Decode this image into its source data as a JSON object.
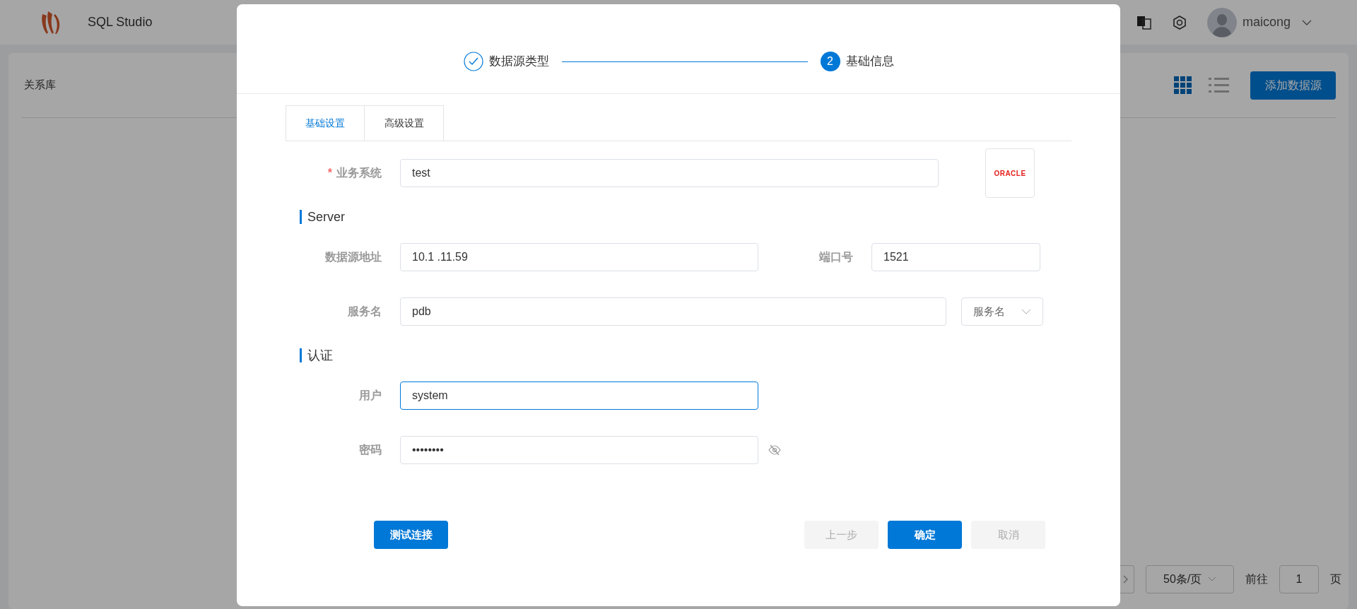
{
  "app": {
    "title": "SQL Studio",
    "user": "maicong"
  },
  "page": {
    "title": "关系库",
    "add_button": "添加数据源",
    "views": [
      {
        "kind": "grid",
        "selected": true
      },
      {
        "kind": "list",
        "selected": false
      }
    ]
  },
  "pagination": {
    "page_size": "50条/页",
    "goto_label": "前往",
    "page": "1",
    "page_unit": "页"
  },
  "dialog": {
    "steps": [
      {
        "label": "数据源类型",
        "done": true
      },
      {
        "label": "基础信息",
        "number": "2",
        "done": false
      }
    ],
    "tabs": [
      {
        "label": "基础设置",
        "selected": true
      },
      {
        "label": "高级设置",
        "selected": false
      }
    ],
    "logo": "ORACLE",
    "required_mark": "*",
    "rows": [
      {
        "kind": "fields",
        "fields": [
          {
            "label": "业务系统",
            "required": true,
            "value": "test",
            "focused": false
          }
        ]
      },
      {
        "kind": "heading",
        "label": "Server"
      },
      {
        "kind": "fields",
        "fields": [
          {
            "label": "数据源地址",
            "required": false,
            "value": "10.1 .11.59",
            "focused": false
          },
          {
            "label": "端口号",
            "required": false,
            "value": "1521",
            "focused": false
          }
        ]
      },
      {
        "kind": "fields",
        "fields": [
          {
            "label": "服务名",
            "required": false,
            "value": "pdb",
            "focused": false
          }
        ],
        "select": "服务名"
      },
      {
        "kind": "heading",
        "label": "认证"
      },
      {
        "kind": "fields",
        "fields": [
          {
            "label": "用户",
            "required": false,
            "value": "system",
            "focused": true
          }
        ]
      },
      {
        "kind": "fields",
        "fields": [
          {
            "label": "密码",
            "required": false,
            "value": "••••••••",
            "focused": false,
            "masked": true
          }
        ]
      }
    ],
    "buttons": [
      {
        "label": "测试连接",
        "kind": "primary",
        "disabled": false
      },
      {
        "label": "上一步",
        "kind": "default",
        "disabled": true
      },
      {
        "label": "确定",
        "kind": "primary",
        "disabled": false
      },
      {
        "label": "取消",
        "kind": "default",
        "disabled": true
      }
    ]
  }
}
